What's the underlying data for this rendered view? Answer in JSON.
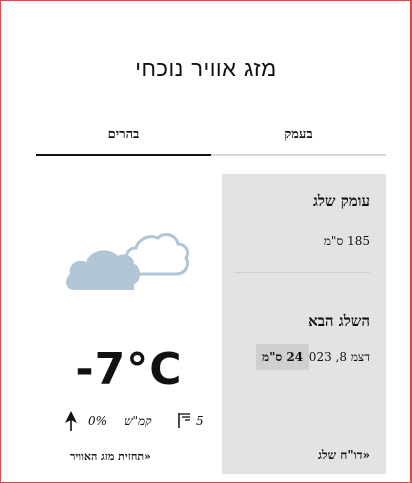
{
  "header": {
    "title": "מזג אוויר נוכחי"
  },
  "tabs": [
    {
      "label": "בעמק",
      "active": false
    },
    {
      "label": "בהרים",
      "active": true
    }
  ],
  "weather": {
    "icon": "cloud-icon",
    "temperature": "-7°C",
    "wind_speed": "5",
    "wind_unit": "קמ\"ש",
    "precip": "0%",
    "forecast_link": "«תחזית מזג האוויר"
  },
  "snow": {
    "depth_title": "עומק שלג",
    "depth_value": "185 ס\"מ",
    "next_title": "השלג הבא",
    "next_date": "דצמ 8, 2023",
    "next_amount": "24 ס\"מ",
    "report_link": "«דו\"ח שלג"
  },
  "colors": {
    "border": "#d94a4a",
    "panel_bg": "#e3e3e3",
    "cloud": "#b1c5d6",
    "badge_bg": "#cfcfcf"
  }
}
